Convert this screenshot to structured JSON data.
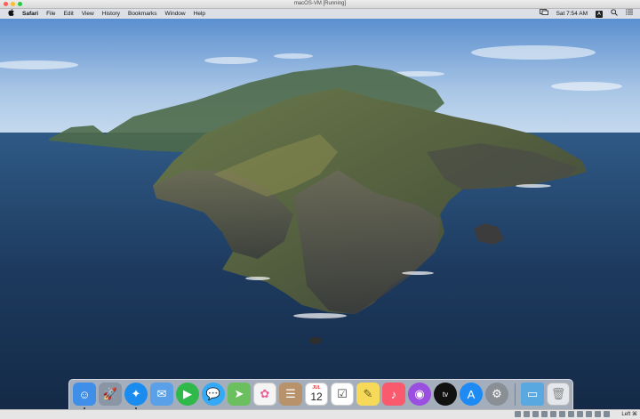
{
  "window": {
    "title": "macOS-VM [Running]"
  },
  "menubar": {
    "apple_icon": "apple-icon",
    "items": [
      "Safari",
      "File",
      "Edit",
      "View",
      "History",
      "Bookmarks",
      "Window",
      "Help"
    ],
    "clock": "Sat 7:54 AM",
    "input_badge": "A",
    "status_icons": [
      "display-mirroring-icon",
      "search-icon",
      "control-center-icon"
    ]
  },
  "dock": {
    "apps": [
      {
        "name": "Finder",
        "icon": "finder-icon",
        "color": "#3f8ee8",
        "running": true
      },
      {
        "name": "Launchpad",
        "icon": "launchpad-icon",
        "color": "#8a96a6",
        "running": false
      },
      {
        "name": "Safari",
        "icon": "safari-icon",
        "color": "#1a8cf0",
        "running": true
      },
      {
        "name": "Mail",
        "icon": "mail-icon",
        "color": "#5aa0e8",
        "running": false
      },
      {
        "name": "FaceTime",
        "icon": "facetime-icon",
        "color": "#2fb94a",
        "running": false
      },
      {
        "name": "Messages",
        "icon": "messages-icon",
        "color": "#34a9f5",
        "running": false
      },
      {
        "name": "Maps",
        "icon": "maps-icon",
        "color": "#6cbf5e",
        "running": false
      },
      {
        "name": "Photos",
        "icon": "photos-icon",
        "color": "#f4f4f4",
        "running": false
      },
      {
        "name": "Contacts",
        "icon": "contacts-icon",
        "color": "#b8926a",
        "running": false
      },
      {
        "name": "Calendar",
        "icon": "calendar-icon",
        "color": "#ffffff",
        "running": false,
        "month": "JUL",
        "day": "12"
      },
      {
        "name": "Reminders",
        "icon": "reminders-icon",
        "color": "#ffffff",
        "running": false
      },
      {
        "name": "Notes",
        "icon": "notes-icon",
        "color": "#f7d95a",
        "running": false
      },
      {
        "name": "Music",
        "icon": "music-icon",
        "color": "#fa5a6e",
        "running": false
      },
      {
        "name": "Podcasts",
        "icon": "podcasts-icon",
        "color": "#9b4fe0",
        "running": false
      },
      {
        "name": "TV",
        "icon": "tv-icon",
        "color": "#111111",
        "running": false
      },
      {
        "name": "App Store",
        "icon": "app-store-icon",
        "color": "#1e8bf5",
        "running": false
      },
      {
        "name": "System Preferences",
        "icon": "system-preferences-icon",
        "color": "#8a8f96",
        "running": false
      }
    ],
    "downloads_icon": "downloads-folder-icon",
    "trash_icon": "trash-icon"
  },
  "statusbar": {
    "host_key": "Left ⌘"
  },
  "colors": {
    "sky_top": "#5b8fcf",
    "sky_horizon": "#c9dcef",
    "ocean": "#1d3a5e",
    "island": "#4c5a3a"
  }
}
